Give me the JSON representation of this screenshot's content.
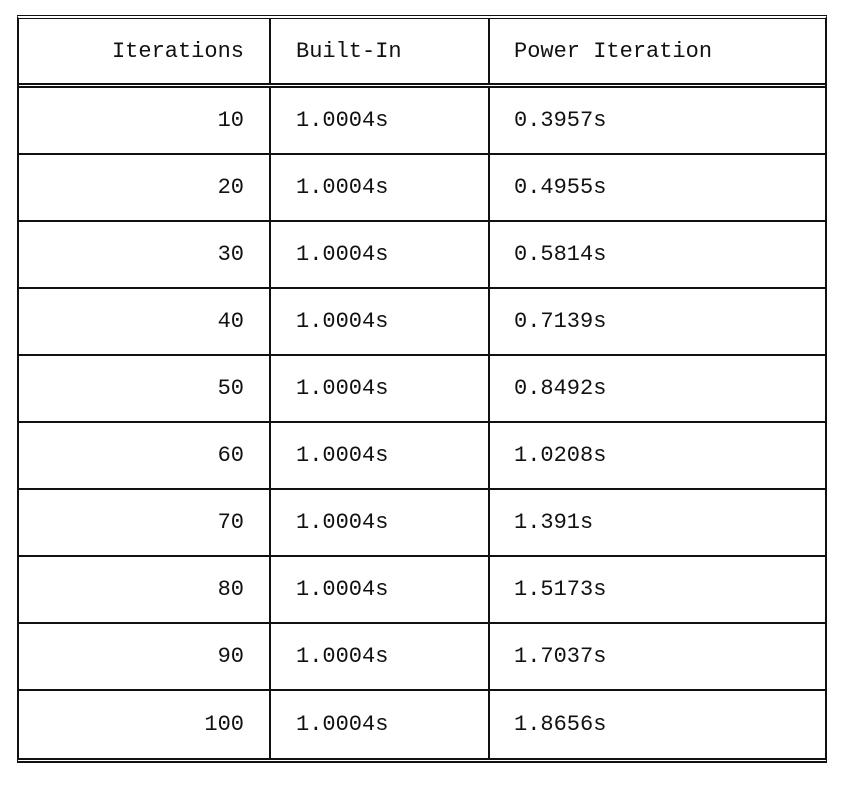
{
  "table": {
    "headers": [
      "Iterations",
      "Built-In",
      "Power Iteration"
    ],
    "rows": [
      [
        "10",
        "1.0004s",
        "0.3957s"
      ],
      [
        "20",
        "1.0004s",
        "0.4955s"
      ],
      [
        "30",
        "1.0004s",
        "0.5814s"
      ],
      [
        "40",
        "1.0004s",
        "0.7139s"
      ],
      [
        "50",
        "1.0004s",
        "0.8492s"
      ],
      [
        "60",
        "1.0004s",
        "1.0208s"
      ],
      [
        "70",
        "1.0004s",
        "1.391s"
      ],
      [
        "80",
        "1.0004s",
        "1.5173s"
      ],
      [
        "90",
        "1.0004s",
        "1.7037s"
      ],
      [
        "100",
        "1.0004s",
        "1.8656s"
      ]
    ]
  }
}
